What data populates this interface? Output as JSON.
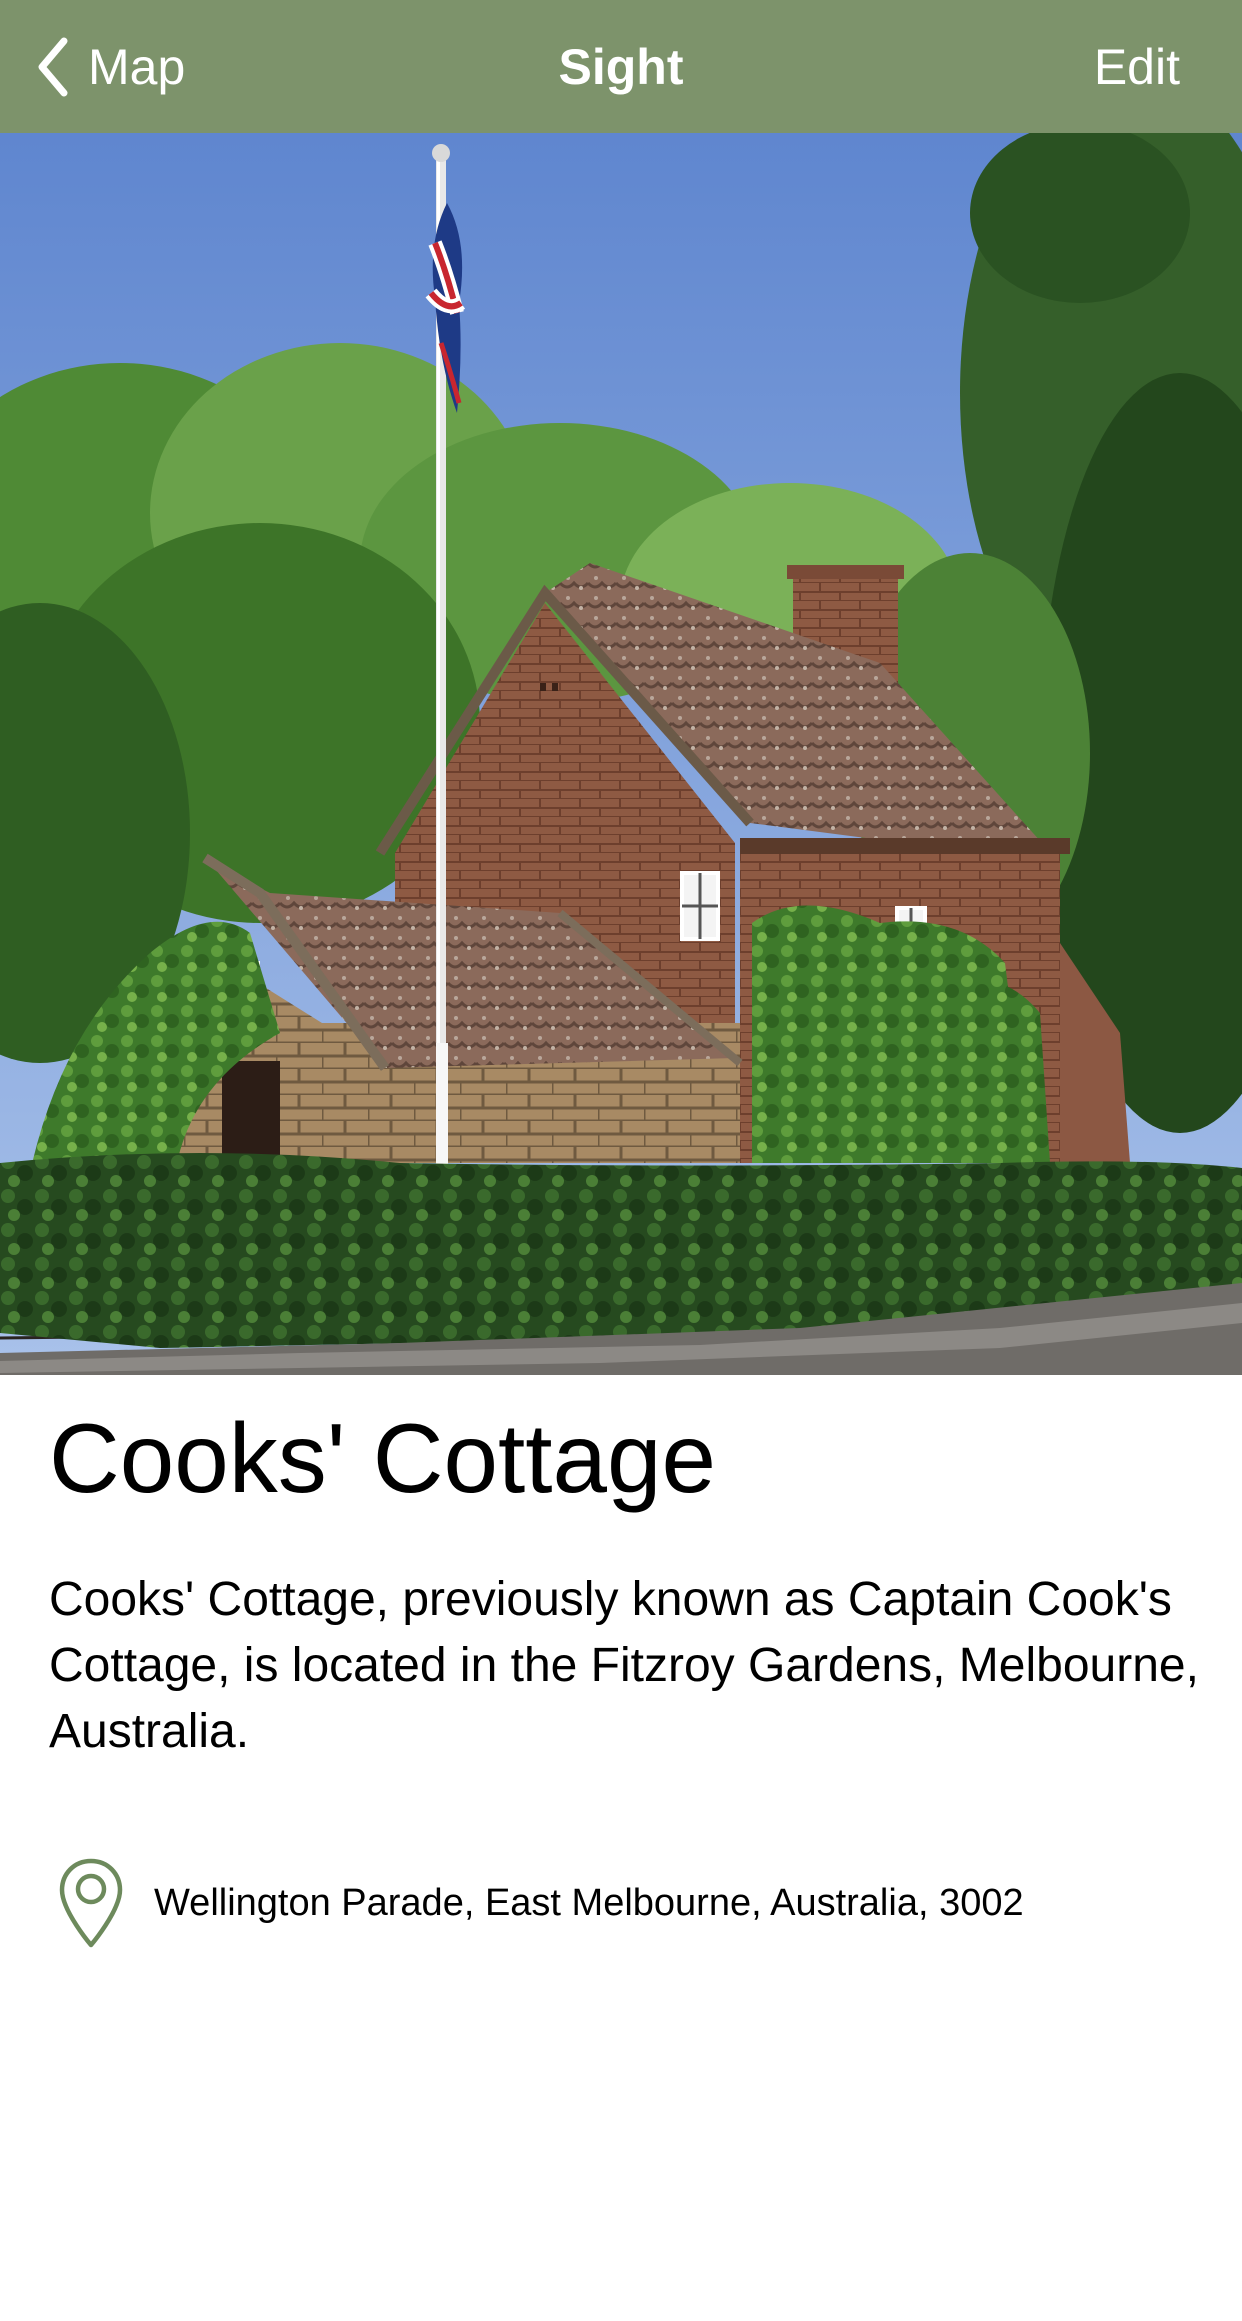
{
  "nav": {
    "back_label": "Map",
    "title": "Sight",
    "edit_label": "Edit",
    "bar_color": "#7d936b",
    "back_icon": "chevron-left-icon"
  },
  "sight": {
    "name": "Cooks' Cottage",
    "description": "Cooks' Cottage, previously known as Captain Cook's Cottage, is located in the Fitzroy Gardens, Melbourne, Australia.",
    "address": "Wellington Parade, East Melbourne, Australia, 3002",
    "address_icon": "map-pin-icon",
    "accent_color": "#6d8a5c"
  }
}
